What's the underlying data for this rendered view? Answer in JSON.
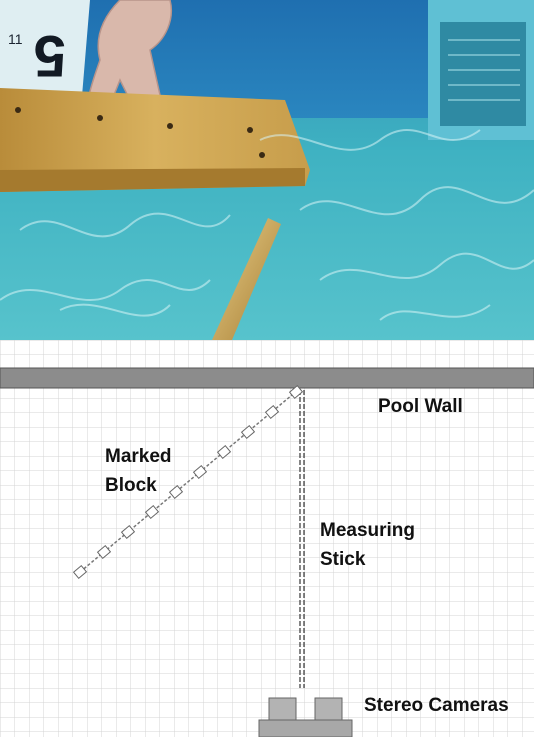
{
  "labels": {
    "pool_wall": "Pool Wall",
    "marked_block_line1": "Marked",
    "marked_block_line2": "Block",
    "measuring_stick_line1": "Measuring",
    "measuring_stick_line2": "Stick",
    "stereo_cameras": "Stereo Cameras"
  },
  "photo": {
    "lane_number": "5",
    "small_digits": "11"
  },
  "colors": {
    "water": "#3fb2c2",
    "wall_bar": "#8c8c8c",
    "grid_line": "#d2d2d2",
    "block_wood": "#c9a24a"
  }
}
